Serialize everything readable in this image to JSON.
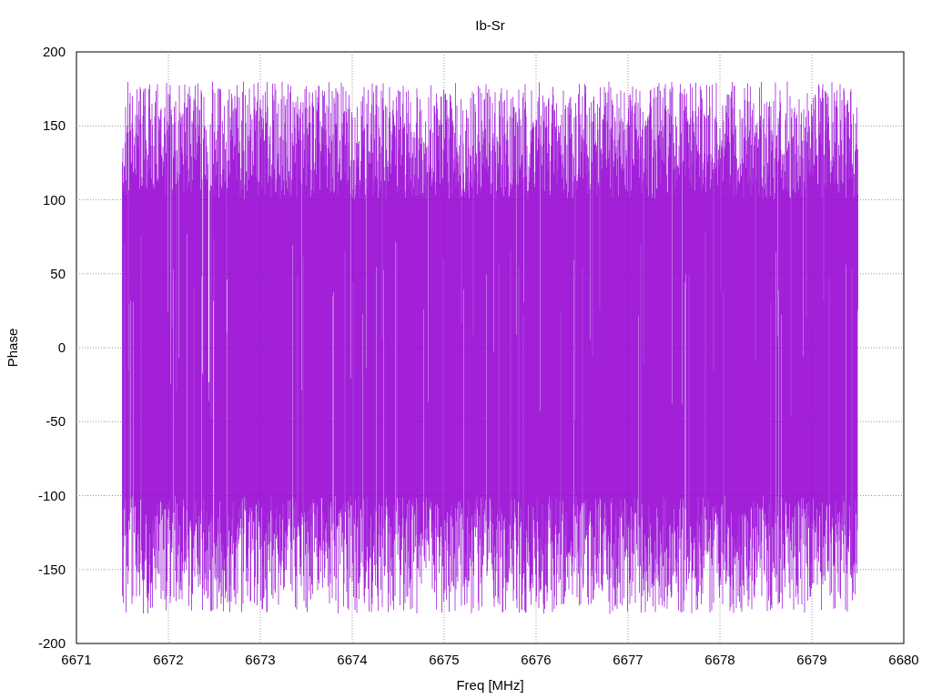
{
  "title": "Ib-Sr",
  "ylabel": "Phase",
  "xlabel": "Freq [MHz]",
  "yticks": [
    "200",
    "150",
    "100",
    "50",
    "0",
    "-50",
    "-100",
    "-150",
    "-200"
  ],
  "xticks": [
    "6671",
    "6672",
    "6673",
    "6674",
    "6675",
    "6676",
    "6677",
    "6678",
    "6679",
    "6680"
  ]
}
